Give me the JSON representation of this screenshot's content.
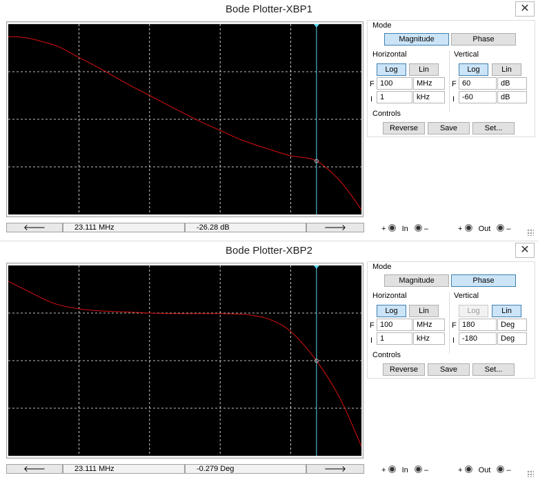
{
  "windows": [
    {
      "title": "Bode Plotter-XBP1",
      "close_glyph": "✕",
      "mode_label": "Mode",
      "mode_buttons": {
        "magnitude": "Magnitude",
        "phase": "Phase",
        "active": "magnitude"
      },
      "horizontal": {
        "label": "Horizontal",
        "log": "Log",
        "lin": "Lin",
        "active": "log",
        "f_label": "F",
        "f_value": "100",
        "f_unit": "MHz",
        "i_label": "I",
        "i_value": "1",
        "i_unit": "kHz"
      },
      "vertical": {
        "label": "Vertical",
        "log": "Log",
        "lin": "Lin",
        "active": "log",
        "log_disabled": false,
        "f_label": "F",
        "f_value": "60",
        "f_unit": "dB",
        "i_label": "I",
        "i_value": "-60",
        "i_unit": "dB"
      },
      "controls": {
        "label": "Controls",
        "reverse": "Reverse",
        "save": "Save",
        "set": "Set..."
      },
      "status": {
        "left_arrow": "🡐",
        "right_arrow": "🡒",
        "frequency": "23.111 MHz",
        "value": "-26.28 dB"
      },
      "terminals": {
        "plus": "+",
        "minus": "–",
        "in": "In",
        "out": "Out"
      },
      "colors": {
        "trace": "#e01010",
        "cursor": "#5ad8f0",
        "grid": "#ffffff",
        "background": "#000000"
      },
      "chart_data": {
        "type": "line",
        "x_scale": "log",
        "xlim": [
          "1 kHz",
          "100 MHz"
        ],
        "ylim": [
          -60,
          60
        ],
        "yunit": "dB",
        "grid": true,
        "cursor": {
          "x": "23.111 MHz",
          "y": -26.28
        },
        "series": [
          {
            "x": [
              1000,
              1300,
              2000,
              3000,
              5000,
              10000,
              20000,
              50000,
              100000,
              200000,
              500000,
              1000000,
              2000000,
              5000000,
              10000000,
              23111000,
              50000000,
              100000000
            ],
            "y": [
              52,
              52,
              51,
              49,
              46,
              39,
              32,
              22,
              15,
              8,
              -1,
              -7,
              -13,
              -19,
              -23,
              -26.28,
              -39,
              -57
            ]
          }
        ]
      }
    },
    {
      "title": "Bode Plotter-XBP2",
      "close_glyph": "✕",
      "mode_label": "Mode",
      "mode_buttons": {
        "magnitude": "Magnitude",
        "phase": "Phase",
        "active": "phase"
      },
      "horizontal": {
        "label": "Horizontal",
        "log": "Log",
        "lin": "Lin",
        "active": "log",
        "f_label": "F",
        "f_value": "100",
        "f_unit": "MHz",
        "i_label": "I",
        "i_value": "1",
        "i_unit": "kHz"
      },
      "vertical": {
        "label": "Vertical",
        "log": "Log",
        "lin": "Lin",
        "active": "lin",
        "log_disabled": true,
        "f_label": "F",
        "f_value": "180",
        "f_unit": "Deg",
        "i_label": "I",
        "i_value": "-180",
        "i_unit": "Deg"
      },
      "controls": {
        "label": "Controls",
        "reverse": "Reverse",
        "save": "Save",
        "set": "Set..."
      },
      "status": {
        "left_arrow": "🡐",
        "right_arrow": "🡒",
        "frequency": "23.111 MHz",
        "value": "-0.279 Deg"
      },
      "terminals": {
        "plus": "+",
        "minus": "–",
        "in": "In",
        "out": "Out"
      },
      "colors": {
        "trace": "#e01010",
        "cursor": "#5ad8f0",
        "grid": "#ffffff",
        "background": "#000000"
      },
      "chart_data": {
        "type": "line",
        "x_scale": "log",
        "xlim": [
          "1 kHz",
          "100 MHz"
        ],
        "ylim": [
          -180,
          180
        ],
        "yunit": "Deg",
        "grid": true,
        "cursor": {
          "x": "23.111 MHz",
          "y": -0.279
        },
        "series": [
          {
            "x": [
              1000,
              2000,
              3000,
              5000,
              10000,
              20000,
              50000,
              100000,
              200000,
              500000,
              1000000,
              2000000,
              3000000,
              5000000,
              10000000,
              23111000,
              50000000,
              100000000
            ],
            "y": [
              150,
              130,
              118,
              106,
              98,
              94,
              92,
              90,
              89,
              89,
              89,
              88,
              85,
              78,
              55,
              -0.279,
              -72,
              -162
            ]
          }
        ]
      }
    }
  ]
}
